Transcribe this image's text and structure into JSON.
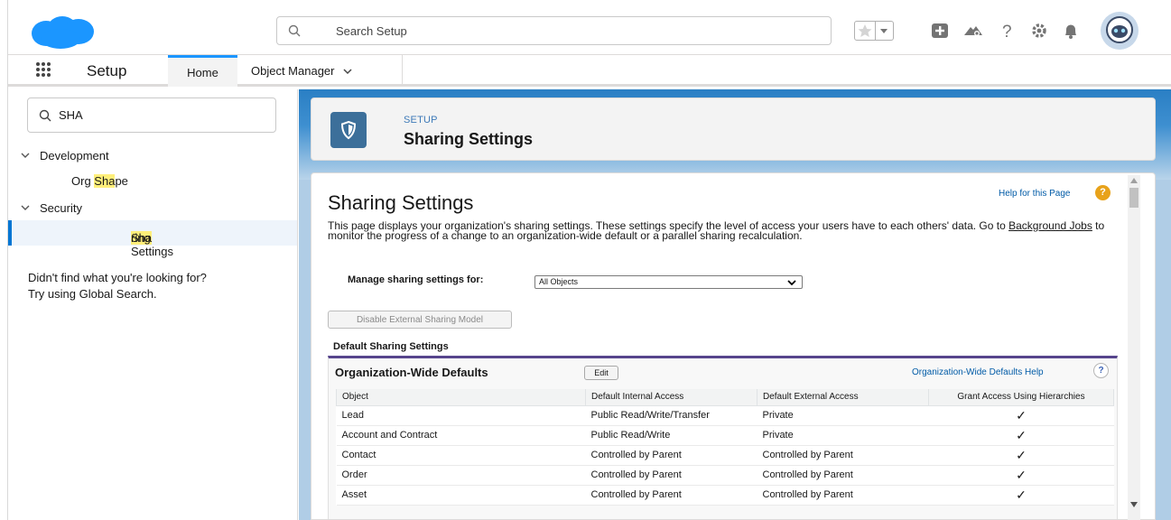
{
  "header": {
    "search_placeholder": "Search Setup",
    "icons": [
      "favorites-star-icon",
      "favorites-dropdown-icon",
      "global-actions-plus-icon",
      "trailhead-icon",
      "help-icon",
      "setup-gear-icon",
      "notifications-bell-icon",
      "user-avatar"
    ]
  },
  "nav": {
    "app_name": "Setup",
    "tabs": [
      {
        "label": "Home",
        "active": true
      },
      {
        "label": "Object Manager",
        "active": false
      }
    ]
  },
  "sidebar": {
    "quick_find_value": "SHA",
    "tree": [
      {
        "label": "Development",
        "children": [
          {
            "pre": "Org ",
            "hl": "Sha",
            "post": "pe"
          }
        ]
      },
      {
        "label": "Security",
        "children": [
          {
            "pre": "",
            "hl": "Sha",
            "post": "ring Settings",
            "selected": true
          }
        ]
      }
    ],
    "not_found_line1": "Didn't find what you're looking for?",
    "not_found_line2": "Try using Global Search."
  },
  "page_header": {
    "eyebrow": "SETUP",
    "title": "Sharing Settings"
  },
  "content": {
    "title": "Sharing Settings",
    "help_link": "Help for this Page",
    "description_pre": "This page displays your organization's sharing settings. These settings specify the level of access your users have to each others' data. Go to ",
    "description_link": "Background Jobs",
    "description_post": " to monitor the progress of a change to an organization-wide default or a parallel sharing recalculation.",
    "manage_label": "Manage sharing settings for:",
    "manage_value": "All Objects",
    "disable_button": "Disable External Sharing Model",
    "section_label": "Default Sharing Settings"
  },
  "owd": {
    "title": "Organization-Wide Defaults",
    "edit_label": "Edit",
    "help_link": "Organization-Wide Defaults Help",
    "columns": [
      "Object",
      "Default Internal Access",
      "Default External Access",
      "Grant Access Using Hierarchies"
    ],
    "rows": [
      {
        "object": "Lead",
        "internal": "Public Read/Write/Transfer",
        "external": "Private",
        "grant": "✓"
      },
      {
        "object": "Account and Contract",
        "internal": "Public Read/Write",
        "external": "Private",
        "grant": "✓"
      },
      {
        "object": "Contact",
        "internal": "Controlled by Parent",
        "external": "Controlled by Parent",
        "grant": "✓"
      },
      {
        "object": "Order",
        "internal": "Controlled by Parent",
        "external": "Controlled by Parent",
        "grant": "✓"
      },
      {
        "object": "Asset",
        "internal": "Controlled by Parent",
        "external": "Controlled by Parent",
        "grant": "✓"
      }
    ]
  },
  "colors": {
    "brand_blue": "#0176d3",
    "cloud_blue": "#1b96ff",
    "header_icon_gray": "#747474",
    "highlight_yellow": "#ffef7a",
    "owd_border_purple": "#56458c",
    "help_orange": "#e8a21a"
  }
}
